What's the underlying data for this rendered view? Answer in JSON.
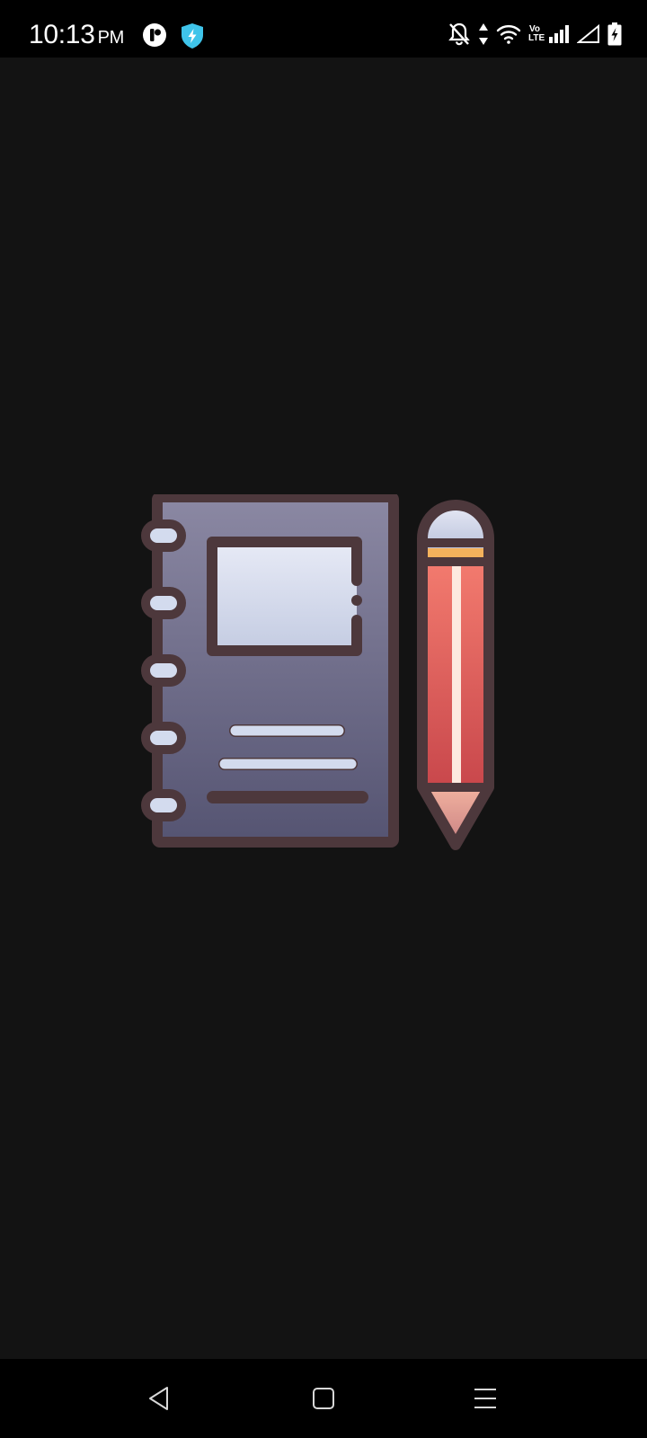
{
  "status_bar": {
    "time": "10:13",
    "ampm": "PM",
    "left_icons": [
      "app-badge-icon",
      "shield-bolt-icon"
    ],
    "right_icons": [
      "notifications-off-icon",
      "data-arrows-icon",
      "wifi-icon",
      "volte-icon",
      "signal-icon",
      "signal-empty-icon",
      "battery-charging-icon"
    ],
    "volte_text": "Vo LTE"
  },
  "splash": {
    "icon": "notebook-pencil-icon",
    "colors": {
      "outline": "#4d383c",
      "cover_top": "#8b88a3",
      "cover_bottom": "#555472",
      "page": "#dfe5f3",
      "pencil_red": "#e4605a",
      "pencil_band": "#f4b25c"
    }
  },
  "nav_bar": {
    "buttons": [
      "back-icon",
      "home-icon",
      "recents-icon"
    ]
  }
}
